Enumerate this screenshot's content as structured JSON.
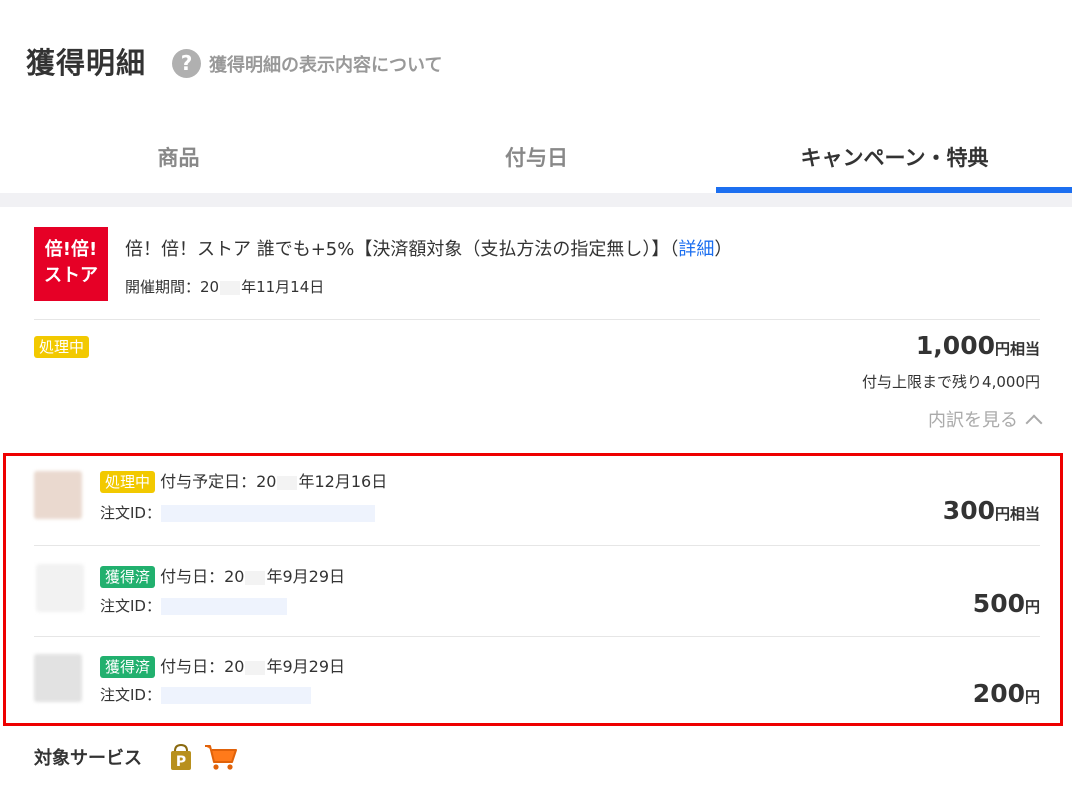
{
  "header": {
    "title": "獲得明細",
    "help_icon_text": "?",
    "help_link": "獲得明細の表示内容について"
  },
  "tabs": [
    {
      "label": "商品",
      "active": false
    },
    {
      "label": "付与日",
      "active": false
    },
    {
      "label": "キャンペーン・特典",
      "active": true
    }
  ],
  "campaign": {
    "logo_line1": "倍!倍!",
    "logo_line2": "ストア",
    "title": "倍！倍！ストア 誰でも+5%【決済額対象（支払方法の指定無し）】（",
    "detail_link": "詳細",
    "title_close": "）",
    "period_prefix": "開催期間：20",
    "period_suffix": "年11月14日",
    "status": "処理中",
    "amount": "1,000",
    "amount_unit": "円相当",
    "remaining": "付与上限まで残り4,000円",
    "breakdown_label": "内訳を見る"
  },
  "breakdown_rows": [
    {
      "status": "処理中",
      "status_type": "processing",
      "date_prefix": "付与予定日：20",
      "date_suffix": "年12月16日",
      "order_label": "注文ID：",
      "amount": "300",
      "amount_unit": "円相当",
      "thumb_color": "#ead9cf"
    },
    {
      "status": "獲得済",
      "status_type": "earned",
      "date_prefix": "付与日：20",
      "date_suffix": "年9月29日",
      "order_label": "注文ID：",
      "amount": "500",
      "amount_unit": "円",
      "thumb_color": "#f2f2f2"
    },
    {
      "status": "獲得済",
      "status_type": "earned",
      "date_prefix": "付与日：20",
      "date_suffix": "年9月29日",
      "order_label": "注文ID：",
      "amount": "200",
      "amount_unit": "円",
      "thumb_color": "#e2e2e2"
    }
  ],
  "services": {
    "label": "対象サービス",
    "icons": [
      "rakuten-pay-icon",
      "shopping-cart-icon"
    ]
  },
  "colors": {
    "accent_blue": "#1c6ff0",
    "processing_yellow": "#f2c900",
    "earned_green": "#21b06e",
    "highlight_red": "#ee0000",
    "store_red": "#e60026"
  }
}
